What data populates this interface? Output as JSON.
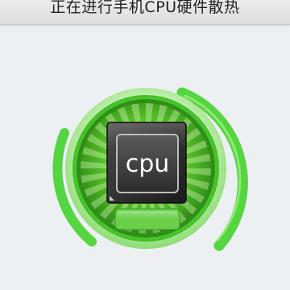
{
  "header": {
    "title": "正在进行手机CPU硬件散热"
  },
  "chip": {
    "label": "cpu",
    "icon": "cpu-chip-icon"
  },
  "colors": {
    "background": "#edf0f3",
    "ring_green": "#48d034",
    "disc_green": "#3fae1c",
    "chip_dark": "#2a2a2a"
  }
}
